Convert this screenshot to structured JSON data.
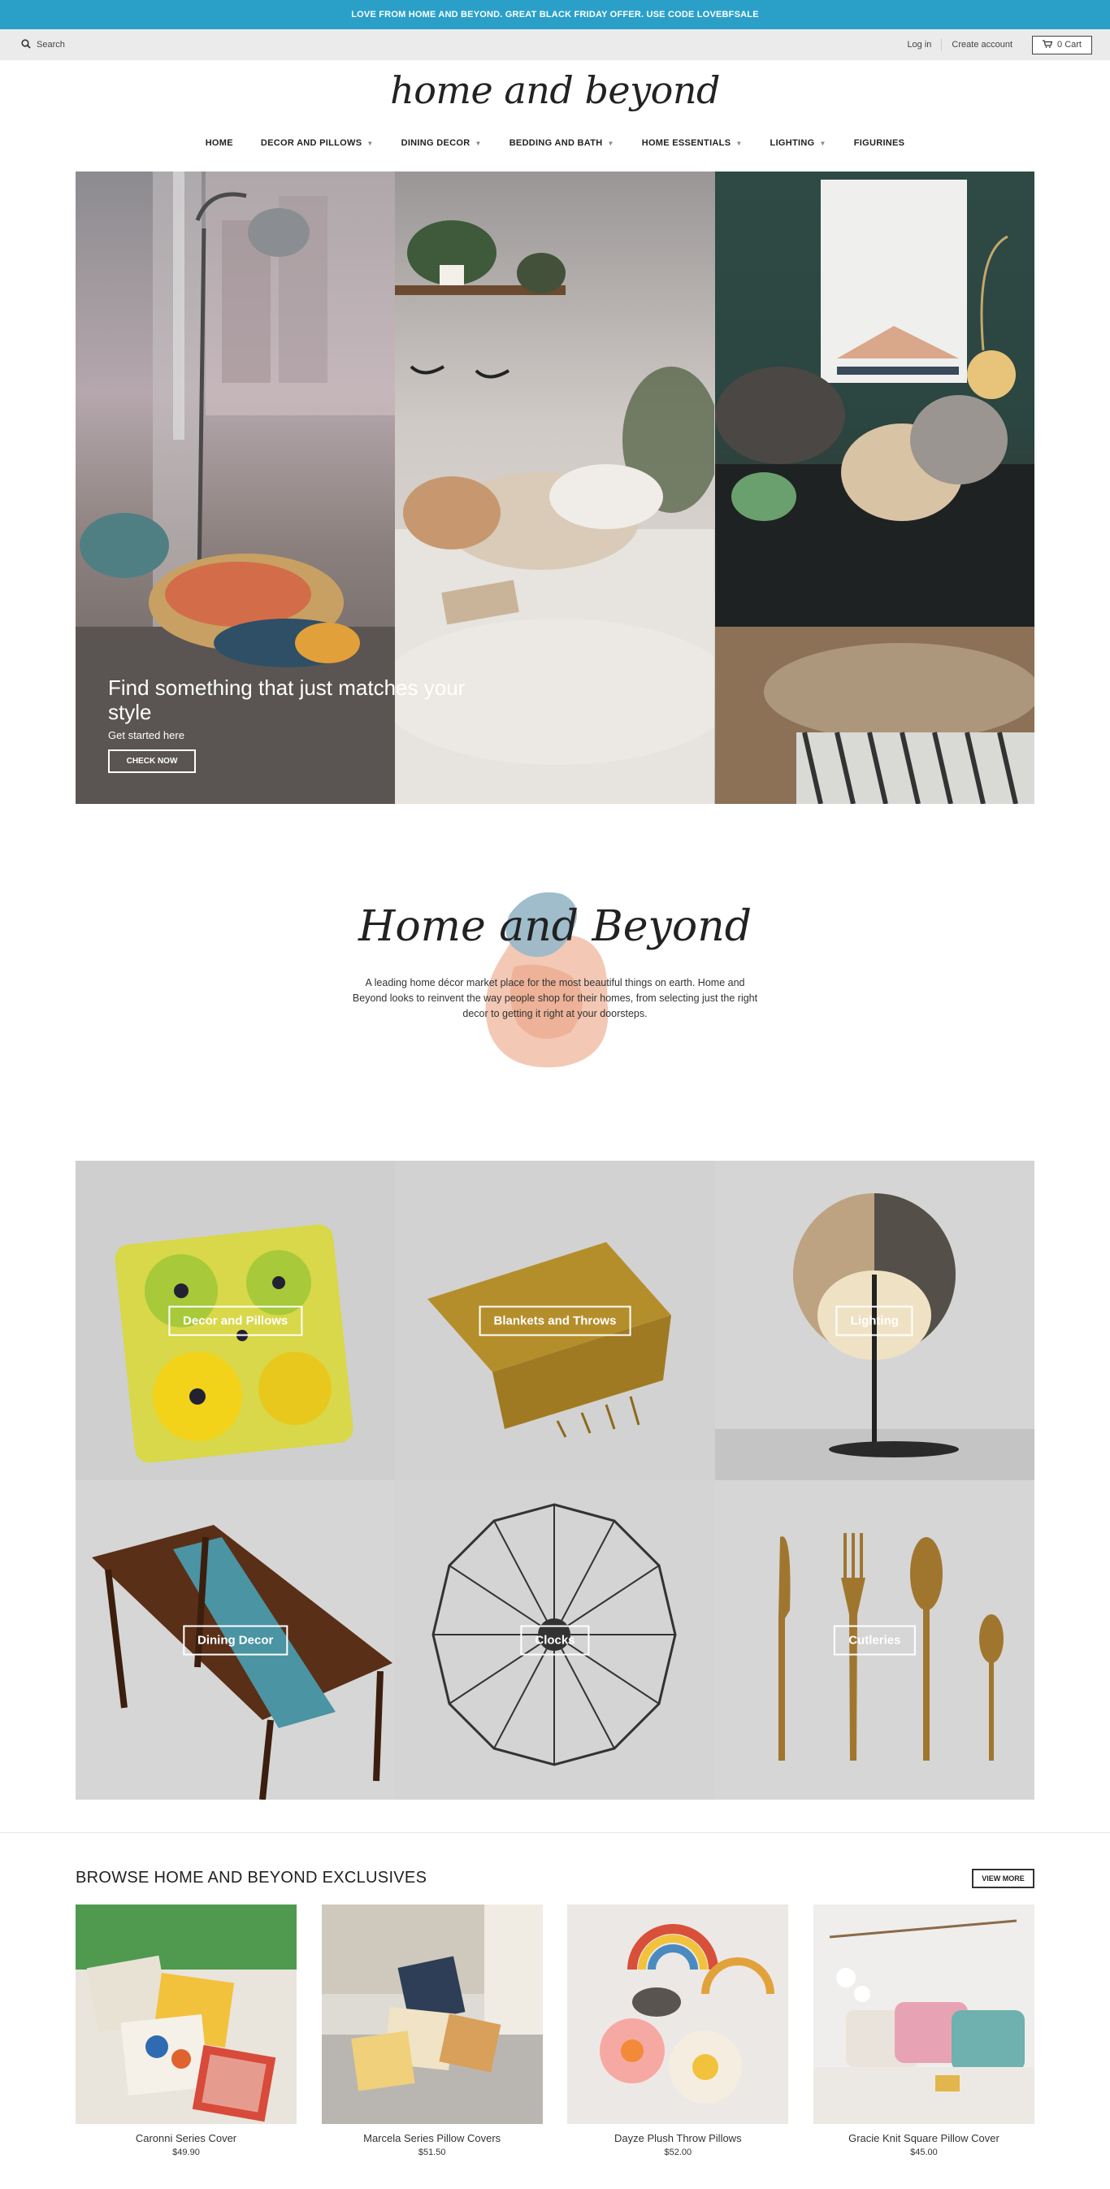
{
  "announcement": "LOVE FROM HOME AND BEYOND. GREAT BLACK FRIDAY OFFER. USE CODE LOVEBFSALE",
  "utility": {
    "search_label": "Search",
    "login_label": "Log in",
    "create_account_label": "Create account",
    "cart_label": "0 Cart"
  },
  "logo_text": "home and beyond",
  "nav": [
    {
      "label": "HOME",
      "has_dropdown": false
    },
    {
      "label": "DECOR AND PILLOWS",
      "has_dropdown": true
    },
    {
      "label": "DINING DECOR",
      "has_dropdown": true
    },
    {
      "label": "BEDDING AND BATH",
      "has_dropdown": true
    },
    {
      "label": "HOME ESSENTIALS",
      "has_dropdown": true
    },
    {
      "label": "LIGHTING",
      "has_dropdown": true
    },
    {
      "label": "FIGURINES",
      "has_dropdown": false
    }
  ],
  "hero": {
    "title": "Find something that just matches your style",
    "subtitle": "Get started here",
    "button_label": "CHECK NOW"
  },
  "about": {
    "title": "Home and Beyond",
    "text": "A leading home décor market place for the most beautiful things on earth. Home and Beyond looks to reinvent the way people shop for their homes, from selecting just the right decor to getting it right at your doorsteps."
  },
  "collections": [
    {
      "label": "Decor and Pillows"
    },
    {
      "label": "Blankets and Throws"
    },
    {
      "label": "Lighting"
    },
    {
      "label": "Dining Decor"
    },
    {
      "label": "Clocks"
    },
    {
      "label": "Cutleries"
    }
  ],
  "featured": {
    "title": "BROWSE HOME AND BEYOND EXCLUSIVES",
    "view_more_label": "VIEW MORE",
    "products": [
      {
        "name": "Caronni Series Cover",
        "price": "$49.90"
      },
      {
        "name": "Marcela Series Pillow Covers",
        "price": "$51.50"
      },
      {
        "name": "Dayze Plush Throw Pillows",
        "price": "$52.00"
      },
      {
        "name": "Gracie Knit Square Pillow Cover",
        "price": "$45.00"
      }
    ]
  },
  "colors": {
    "announcement_bg": "#2aa0c9",
    "utility_bg": "#ebebeb",
    "blob_blue": "#9bb9c9",
    "blob_peach": "#f2c2ad"
  }
}
